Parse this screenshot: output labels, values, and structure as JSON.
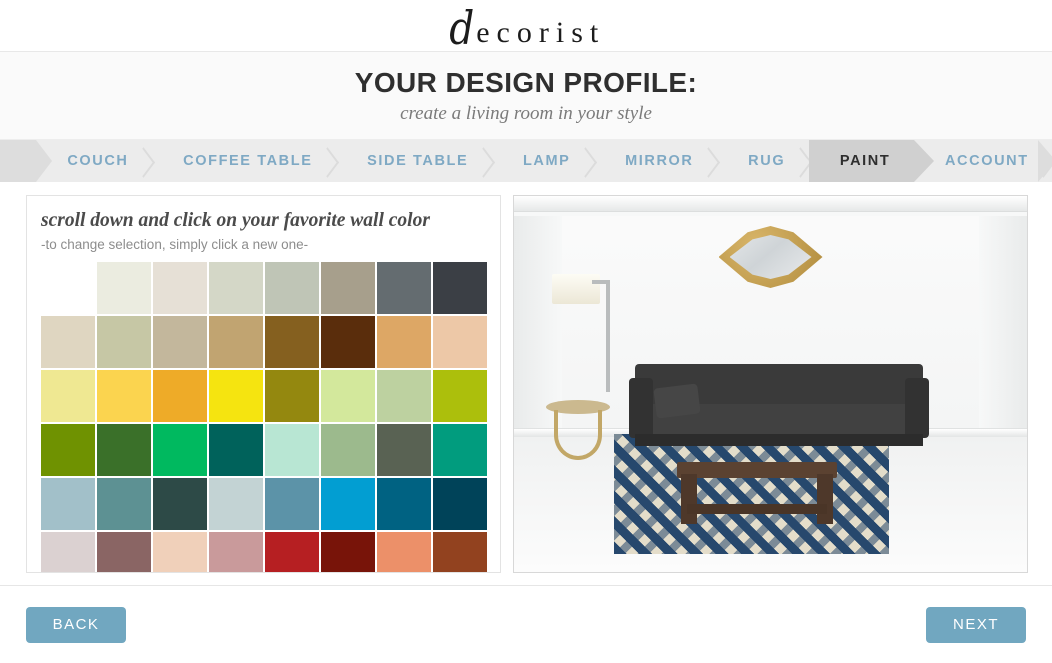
{
  "brand": {
    "logo_script": "d",
    "logo_rest": "ecorist",
    "logo_full": "decorist"
  },
  "header": {
    "title": "YOUR DESIGN PROFILE:",
    "subtitle": "create a living room in your style"
  },
  "steps": [
    {
      "label": "COUCH",
      "active": false
    },
    {
      "label": "COFFEE TABLE",
      "active": false
    },
    {
      "label": "SIDE TABLE",
      "active": false
    },
    {
      "label": "LAMP",
      "active": false
    },
    {
      "label": "MIRROR",
      "active": false
    },
    {
      "label": "RUG",
      "active": false
    },
    {
      "label": "PAINT",
      "active": true
    },
    {
      "label": "ACCOUNT",
      "active": false
    }
  ],
  "panel": {
    "heading": "scroll down and click on your favorite wall color",
    "sub": "-to change selection, simply click a new one-"
  },
  "swatch_rows": [
    [
      "#ffffff",
      "#ebece0",
      "#e6e0d6",
      "#d4d7c7",
      "#bfc5b6",
      "#a79f8c",
      "#646c70",
      "#3b3f45"
    ],
    [
      "#dfd6c1",
      "#c6c7a5",
      "#c3b79c",
      "#c1a471",
      "#85601f",
      "#5a2d0c",
      "#dda765",
      "#edc8a7"
    ],
    [
      "#efe892",
      "#fbd44f",
      "#eeab28",
      "#f5e410",
      "#94880f",
      "#d3e89c",
      "#bdd1a0",
      "#acbf0c"
    ],
    [
      "#6f9201",
      "#3a7029",
      "#00b95f",
      "#00625b",
      "#b8e6d3",
      "#9cba8d",
      "#596253",
      "#019c7e"
    ],
    [
      "#a2c0c9",
      "#5d9193",
      "#2d4a47",
      "#c3d3d4",
      "#5c93a8",
      "#029ed2",
      "#006282",
      "#004359"
    ],
    [
      "#dbd1d1",
      "#8a6564",
      "#f0d0ba",
      "#c99a9b",
      "#b61f22",
      "#781409",
      "#ec9069",
      "#92421f"
    ]
  ],
  "room": {
    "alt": "living room preview with dark sofa, gold quatrefoil mirror, navy geometric rug, wood coffee table, gold side table and floor lamp"
  },
  "footer": {
    "back_label": "BACK",
    "next_label": "NEXT"
  },
  "colors": {
    "accent": "#71a7c0",
    "step_text": "#7fa9c4",
    "step_bg": "#ececec",
    "step_active_bg": "#d0d0d0"
  }
}
